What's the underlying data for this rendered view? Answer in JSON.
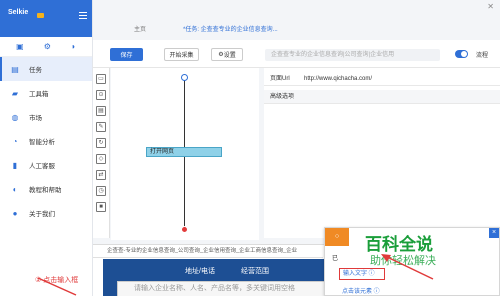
{
  "app": {
    "name": "Selkie"
  },
  "tabs": [
    {
      "label": "主页"
    },
    {
      "label": "*任务: 企查查专业的企业信息查询...",
      "active": true
    }
  ],
  "sidebar": {
    "items": [
      {
        "label": "任务",
        "icon": "tasks-icon",
        "active": true
      },
      {
        "label": "工具箱",
        "icon": "toolbox-icon"
      },
      {
        "label": "市场",
        "icon": "market-icon"
      },
      {
        "label": "智能分析",
        "icon": "analysis-icon"
      },
      {
        "label": "人工客服",
        "icon": "support-icon"
      },
      {
        "label": "教程和帮助",
        "icon": "help-icon"
      },
      {
        "label": "关于我们",
        "icon": "about-icon"
      }
    ]
  },
  "toolbar": {
    "save_label": "保存",
    "collect_label": "开始采集",
    "settings_label": "设置",
    "task_name": "企查查专业的企业信息查询|公司查询|企业信用",
    "flow_label": "流程"
  },
  "flow": {
    "node_label": "打开网页"
  },
  "properties": {
    "url_label": "页面Url",
    "url_value": "http://www.qichacha.com/",
    "advanced_label": "高级选项"
  },
  "browser": {
    "address": "企查查-专业的企业信息查询_公司查询_企业信用查询_企业工商信息查询_企业",
    "nav_items": [
      "地址/电话",
      "经营范围"
    ],
    "search_placeholder": "请输入企业名称、人名、产品名等，多关键词用空格",
    "hint": "① 点击输入框"
  },
  "popup": {
    "head": "○",
    "text": "已",
    "watermark_main": "百科全说",
    "watermark_sub": "助你轻松解决",
    "option_input": "输入文字 ⓘ",
    "option_click": "点击该元素 ⓘ"
  },
  "colors": {
    "accent": "#2f6fd6",
    "warning": "#f08a24",
    "alert": "#e03a3a"
  }
}
